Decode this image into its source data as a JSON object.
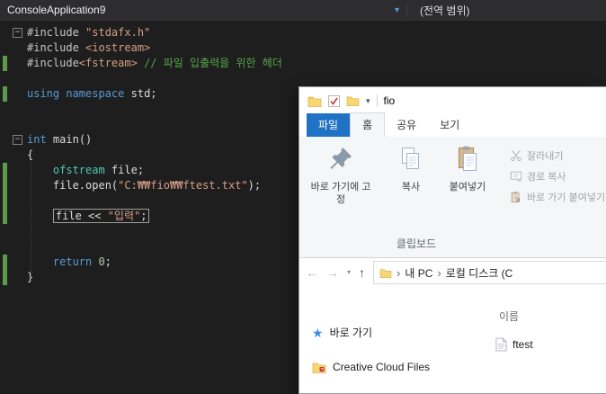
{
  "icons": {
    "caret_down": "▾",
    "back": "←",
    "forward": "→",
    "up": "↑",
    "history_caret": "▾",
    "crumb_chevron": "›",
    "star": "★",
    "fold_collapse": "−"
  },
  "editor": {
    "navbar": {
      "project": "ConsoleApplication9",
      "scope": "(전역 범위)"
    },
    "lines": [
      {
        "fold": true,
        "tokens": [
          [
            "pp",
            "#include "
          ],
          [
            "str",
            "\"stdafx.h\""
          ]
        ]
      },
      {
        "tokens": [
          [
            "pp",
            "#include "
          ],
          [
            "str",
            "<iostream>"
          ]
        ]
      },
      {
        "changed": true,
        "tokens": [
          [
            "pp",
            "#include"
          ],
          [
            "str",
            "<fstream>"
          ],
          [
            "def",
            " "
          ],
          [
            "com",
            "// 파일 입출력을 위한 헤더"
          ]
        ]
      },
      {
        "tokens": []
      },
      {
        "changed": true,
        "tokens": [
          [
            "kw",
            "using"
          ],
          [
            "def",
            " "
          ],
          [
            "kw",
            "namespace"
          ],
          [
            "def",
            " std;"
          ]
        ]
      },
      {
        "tokens": []
      },
      {
        "tokens": []
      },
      {
        "fold": true,
        "tokens": [
          [
            "kw",
            "int"
          ],
          [
            "def",
            " "
          ],
          [
            "fn",
            "main"
          ],
          [
            "def",
            "()"
          ]
        ]
      },
      {
        "tokens": [
          [
            "def",
            "{"
          ]
        ]
      },
      {
        "changed": true,
        "tokens": [
          [
            "def",
            "    "
          ],
          [
            "type",
            "ofstream"
          ],
          [
            "def",
            " file;"
          ]
        ]
      },
      {
        "changed": true,
        "tokens": [
          [
            "def",
            "    file.open("
          ],
          [
            "str",
            "\"C:₩₩fio₩₩ftest.txt\""
          ],
          [
            "def",
            ");"
          ]
        ]
      },
      {
        "changed": true,
        "tokens": []
      },
      {
        "changed": true,
        "boxed": true,
        "indent": "    ",
        "tokens": [
          [
            "def",
            "file << "
          ],
          [
            "str",
            "\"입력\""
          ],
          [
            "def",
            ";"
          ]
        ]
      },
      {
        "tokens": []
      },
      {
        "tokens": []
      },
      {
        "changed": true,
        "tokens": [
          [
            "def",
            "    "
          ],
          [
            "kw",
            "return"
          ],
          [
            "def",
            " "
          ],
          [
            "num",
            "0"
          ],
          [
            "def",
            ";"
          ]
        ]
      },
      {
        "changed": true,
        "tokens": [
          [
            "def",
            "}"
          ]
        ]
      }
    ]
  },
  "explorer": {
    "title": "fio",
    "tabs": {
      "file": "파일",
      "home": "홈",
      "share": "공유",
      "view": "보기"
    },
    "ribbon": {
      "pin_label": "바로 가기에 고정",
      "copy_label": "복사",
      "paste_label": "붙여넣기",
      "cut_label": "잘라내기",
      "copy_path_label": "경로 복사",
      "paste_shortcut_label": "바로 가기 붙여넣기",
      "group_label": "클립보드"
    },
    "address": {
      "crumb1": "내 PC",
      "crumb2": "로컬 디스크 (C"
    },
    "sidebar": {
      "quick_access": "바로 가기",
      "creative_cloud": "Creative Cloud Files"
    },
    "files": {
      "name_header": "이름",
      "file1": "ftest"
    }
  }
}
